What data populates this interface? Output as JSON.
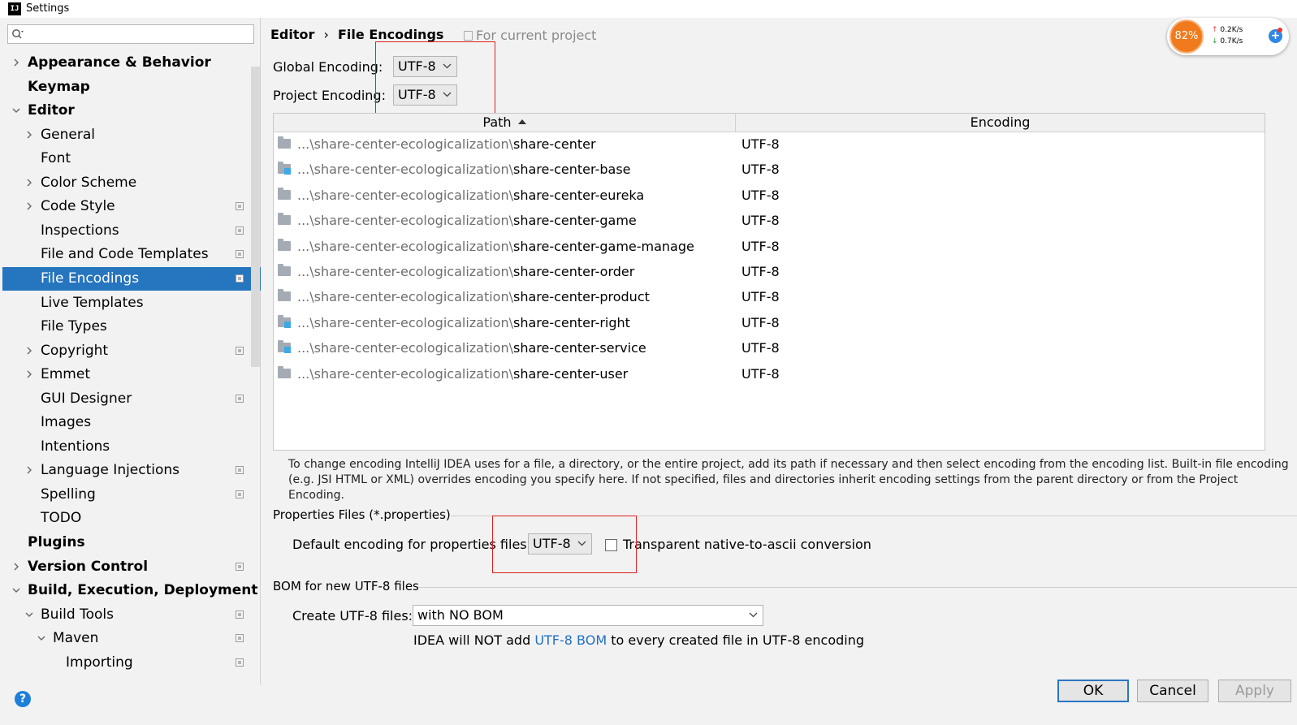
{
  "window": {
    "title": "Settings",
    "app_icon": "IJ"
  },
  "search": {
    "placeholder": "",
    "value": ""
  },
  "sidebar": {
    "items": [
      {
        "label": "Appearance & Behavior",
        "level": 0,
        "bold": true,
        "arrow": "collapsed",
        "project": false
      },
      {
        "label": "Keymap",
        "level": 0,
        "bold": true,
        "arrow": "none",
        "project": false
      },
      {
        "label": "Editor",
        "level": 0,
        "bold": true,
        "arrow": "expanded",
        "project": false
      },
      {
        "label": "General",
        "level": 1,
        "bold": false,
        "arrow": "collapsed",
        "project": false
      },
      {
        "label": "Font",
        "level": 1,
        "bold": false,
        "arrow": "none",
        "project": false
      },
      {
        "label": "Color Scheme",
        "level": 1,
        "bold": false,
        "arrow": "collapsed",
        "project": false
      },
      {
        "label": "Code Style",
        "level": 1,
        "bold": false,
        "arrow": "collapsed",
        "project": true
      },
      {
        "label": "Inspections",
        "level": 1,
        "bold": false,
        "arrow": "none",
        "project": true
      },
      {
        "label": "File and Code Templates",
        "level": 1,
        "bold": false,
        "arrow": "none",
        "project": true
      },
      {
        "label": "File Encodings",
        "level": 1,
        "bold": false,
        "arrow": "none",
        "project": true,
        "selected": true
      },
      {
        "label": "Live Templates",
        "level": 1,
        "bold": false,
        "arrow": "none",
        "project": false
      },
      {
        "label": "File Types",
        "level": 1,
        "bold": false,
        "arrow": "none",
        "project": false
      },
      {
        "label": "Copyright",
        "level": 1,
        "bold": false,
        "arrow": "collapsed",
        "project": true
      },
      {
        "label": "Emmet",
        "level": 1,
        "bold": false,
        "arrow": "collapsed",
        "project": false
      },
      {
        "label": "GUI Designer",
        "level": 1,
        "bold": false,
        "arrow": "none",
        "project": true
      },
      {
        "label": "Images",
        "level": 1,
        "bold": false,
        "arrow": "none",
        "project": false
      },
      {
        "label": "Intentions",
        "level": 1,
        "bold": false,
        "arrow": "none",
        "project": false
      },
      {
        "label": "Language Injections",
        "level": 1,
        "bold": false,
        "arrow": "collapsed",
        "project": true
      },
      {
        "label": "Spelling",
        "level": 1,
        "bold": false,
        "arrow": "none",
        "project": true
      },
      {
        "label": "TODO",
        "level": 1,
        "bold": false,
        "arrow": "none",
        "project": false
      },
      {
        "label": "Plugins",
        "level": 0,
        "bold": true,
        "arrow": "none",
        "project": false
      },
      {
        "label": "Version Control",
        "level": 0,
        "bold": true,
        "arrow": "collapsed",
        "project": true
      },
      {
        "label": "Build, Execution, Deployment",
        "level": 0,
        "bold": true,
        "arrow": "expanded",
        "project": false
      },
      {
        "label": "Build Tools",
        "level": 1,
        "bold": false,
        "arrow": "expanded",
        "project": true
      },
      {
        "label": "Maven",
        "level": 2,
        "bold": false,
        "arrow": "expanded",
        "project": true
      },
      {
        "label": "Importing",
        "level": 3,
        "bold": false,
        "arrow": "none",
        "project": true
      }
    ]
  },
  "breadcrumb": {
    "parent": "Editor",
    "separator": "›",
    "current": "File Encodings",
    "scope": "For current project"
  },
  "encodings": {
    "global_label": "Global Encoding:",
    "global_value": "UTF-8",
    "project_label": "Project Encoding:",
    "project_value": "UTF-8"
  },
  "table": {
    "columns": [
      "Path",
      "Encoding"
    ],
    "rows": [
      {
        "prefix": "...\\share-center-ecologicalization\\",
        "name": "share-center",
        "encoding": "UTF-8",
        "module": false
      },
      {
        "prefix": "...\\share-center-ecologicalization\\",
        "name": "share-center-base",
        "encoding": "UTF-8",
        "module": true
      },
      {
        "prefix": "...\\share-center-ecologicalization\\",
        "name": "share-center-eureka",
        "encoding": "UTF-8",
        "module": false
      },
      {
        "prefix": "...\\share-center-ecologicalization\\",
        "name": "share-center-game",
        "encoding": "UTF-8",
        "module": false
      },
      {
        "prefix": "...\\share-center-ecologicalization\\",
        "name": "share-center-game-manage",
        "encoding": "UTF-8",
        "module": false
      },
      {
        "prefix": "...\\share-center-ecologicalization\\",
        "name": "share-center-order",
        "encoding": "UTF-8",
        "module": false
      },
      {
        "prefix": "...\\share-center-ecologicalization\\",
        "name": "share-center-product",
        "encoding": "UTF-8",
        "module": false
      },
      {
        "prefix": "...\\share-center-ecologicalization\\",
        "name": "share-center-right",
        "encoding": "UTF-8",
        "module": true
      },
      {
        "prefix": "...\\share-center-ecologicalization\\",
        "name": "share-center-service",
        "encoding": "UTF-8",
        "module": true
      },
      {
        "prefix": "...\\share-center-ecologicalization\\",
        "name": "share-center-user",
        "encoding": "UTF-8",
        "module": false
      }
    ]
  },
  "help_text": "To change encoding IntelliJ IDEA uses for a file, a directory, or the entire project, add its path if necessary and then select encoding from the encoding list. Built-in file encoding (e.g. JSI HTML or XML) overrides encoding you specify here. If not specified, files and directories inherit encoding settings from the parent directory or from the Project Encoding.",
  "properties": {
    "section_title": "Properties Files (*.properties)",
    "default_label": "Default encoding for properties files:",
    "default_value": "UTF-8",
    "transparent_label": "Transparent native-to-ascii conversion",
    "transparent_checked": false
  },
  "bom": {
    "section_title": "BOM for new UTF-8 files",
    "create_label": "Create UTF-8 files:",
    "create_value": "with NO BOM",
    "note_before": "IDEA will NOT add ",
    "note_link": "UTF-8 BOM",
    "note_after": " to every created file in UTF-8 encoding"
  },
  "buttons": {
    "ok": "OK",
    "cancel": "Cancel",
    "apply": "Apply",
    "help": "?"
  },
  "monitor": {
    "cpu": "82%",
    "up": "0.2K/s",
    "down": "0.7K/s"
  },
  "colors": {
    "selection": "#2675bf",
    "link": "#2470c2",
    "annotation": "#e02020",
    "monitor": "#f07a1c"
  }
}
